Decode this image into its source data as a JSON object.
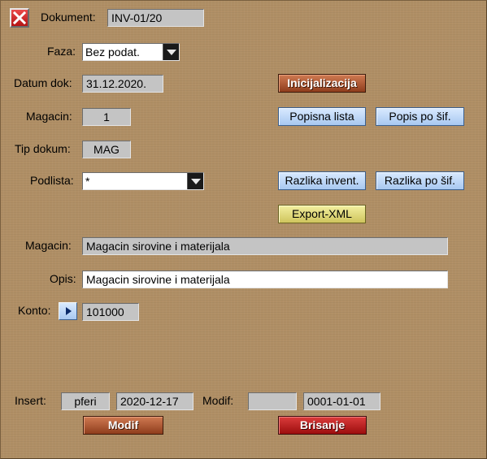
{
  "header": {
    "close_icon": "close-icon",
    "dokument_label": "Dokument:",
    "dokument_value": "INV-01/20"
  },
  "faza": {
    "label": "Faza:",
    "selected": "Bez podat."
  },
  "datum": {
    "label": "Datum dok:",
    "value": "31.12.2020."
  },
  "magacin_code": {
    "label": "Magacin:",
    "value": "1"
  },
  "tip": {
    "label": "Tip dokum:",
    "value": "MAG"
  },
  "podlista": {
    "label": "Podlista:",
    "selected": "*"
  },
  "magacin_name": {
    "label": "Magacin:",
    "value": "Magacin sirovine i materijala"
  },
  "opis": {
    "label": "Opis:",
    "value": "Magacin sirovine i materijala"
  },
  "konto": {
    "label": "Konto:",
    "value": "101000",
    "icon": "arrow-right-icon"
  },
  "buttons": {
    "inicijalizacija": "Inicijalizacija",
    "popisna_lista": "Popisna lista",
    "popis_po_sif": "Popis po šif.",
    "razlika_invent": "Razlika invent.",
    "razlika_po_sif": "Razlika po šif.",
    "export_xml": "Export-XML",
    "modif": "Modif",
    "brisanje": "Brisanje"
  },
  "footer": {
    "insert_label": "Insert:",
    "insert_user": "pferi",
    "insert_date": "2020-12-17",
    "modif_label": "Modif:",
    "modif_user": "",
    "modif_date": "0001-01-01"
  },
  "colors": {
    "background": "#b08f65",
    "blue_button": "#a8c8f0",
    "orange_button": "#8f3d1c",
    "red_button": "#b41414",
    "yellow_button": "#cfc45d"
  }
}
